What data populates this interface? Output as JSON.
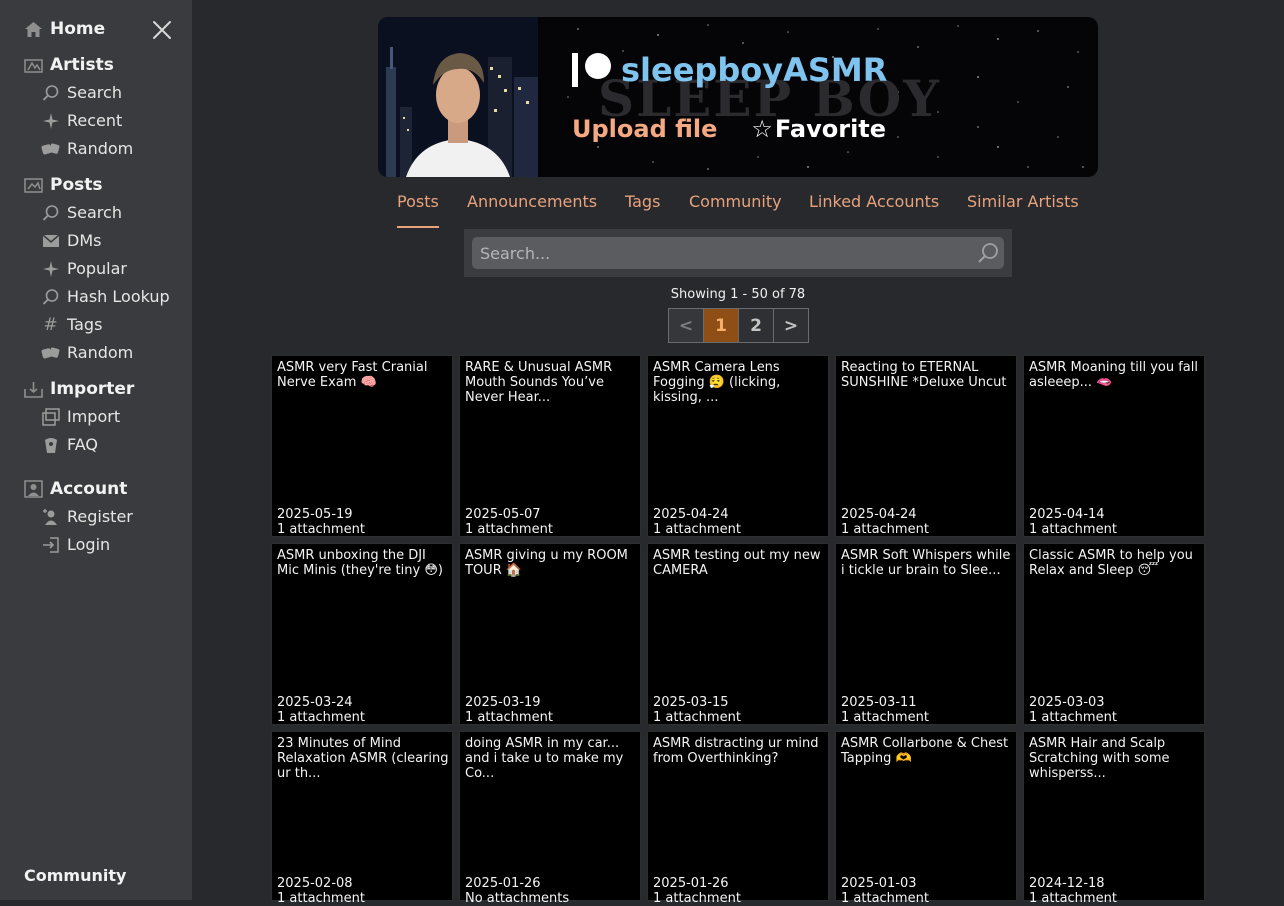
{
  "sidebar": {
    "sections": [
      {
        "title": "Home",
        "icon": "home-icon"
      },
      {
        "title": "Artists",
        "icon": "artists-icon",
        "items": [
          {
            "label": "Search",
            "icon": "search-icon"
          },
          {
            "label": "Recent",
            "icon": "sparkle-icon"
          },
          {
            "label": "Random",
            "icon": "dice-icon"
          }
        ]
      },
      {
        "title": "Posts",
        "icon": "posts-icon",
        "items": [
          {
            "label": "Search",
            "icon": "search-icon"
          },
          {
            "label": "DMs",
            "icon": "mail-icon"
          },
          {
            "label": "Popular",
            "icon": "sparkle-icon"
          },
          {
            "label": "Hash Lookup",
            "icon": "search-icon"
          },
          {
            "label": "Tags",
            "icon": "hash-icon"
          },
          {
            "label": "Random",
            "icon": "dice-icon"
          }
        ]
      },
      {
        "title": "Importer",
        "icon": "importer-icon",
        "items": [
          {
            "label": "Import",
            "icon": "import-icon"
          },
          {
            "label": "FAQ",
            "icon": "faq-icon"
          }
        ]
      },
      {
        "title": "Account",
        "icon": "account-icon",
        "items": [
          {
            "label": "Register",
            "icon": "register-icon"
          },
          {
            "label": "Login",
            "icon": "login-icon"
          }
        ]
      }
    ],
    "footer": "Community"
  },
  "artist": {
    "name": "sleepboyASMR",
    "service_icon": "patreon-icon",
    "banner_text": "SLEEP BOY",
    "upload_label": "Upload file",
    "favorite_label": "Favorite"
  },
  "tabs": [
    "Posts",
    "Announcements",
    "Tags",
    "Community",
    "Linked Accounts",
    "Similar Artists"
  ],
  "active_tab": "Posts",
  "search": {
    "placeholder": "Search..."
  },
  "pagination": {
    "showing": "Showing 1 - 50 of 78",
    "prev": "<",
    "pages": [
      "1",
      "2"
    ],
    "current": "1",
    "next": ">"
  },
  "posts": [
    {
      "title": "ASMR very Fast Cranial Nerve Exam 🧠",
      "date": "2025-05-19",
      "attachments": "1 attachment"
    },
    {
      "title": "RARE & Unusual ASMR Mouth Sounds You’ve Never Hear...",
      "date": "2025-05-07",
      "attachments": "1 attachment"
    },
    {
      "title": "ASMR Camera Lens Fogging 😮‍💨 (licking, kissing, ...",
      "date": "2025-04-24",
      "attachments": "1 attachment"
    },
    {
      "title": "Reacting to ETERNAL SUNSHINE *Deluxe Uncut",
      "date": "2025-04-24",
      "attachments": "1 attachment"
    },
    {
      "title": "ASMR Moaning till you fall asleeep... 🫦",
      "date": "2025-04-14",
      "attachments": "1 attachment"
    },
    {
      "title": "ASMR unboxing the DJI Mic Minis (they're tiny 😳)",
      "date": "2025-03-24",
      "attachments": "1 attachment"
    },
    {
      "title": "ASMR giving u my ROOM TOUR 🏠",
      "date": "2025-03-19",
      "attachments": "1 attachment"
    },
    {
      "title": "ASMR testing out my new CAMERA",
      "date": "2025-03-15",
      "attachments": "1 attachment"
    },
    {
      "title": "ASMR Soft Whispers while i tickle ur brain to Slee...",
      "date": "2025-03-11",
      "attachments": "1 attachment"
    },
    {
      "title": "Classic ASMR to help you Relax and Sleep 😴",
      "date": "2025-03-03",
      "attachments": "1 attachment"
    },
    {
      "title": "23 Minutes of Mind Relaxation ASMR (clearing ur th...",
      "date": "2025-02-08",
      "attachments": "1 attachment"
    },
    {
      "title": "doing ASMR in my car... and i take u to make my Co...",
      "date": "2025-01-26",
      "attachments": "No attachments"
    },
    {
      "title": "ASMR distracting ur mind from Overthinking?",
      "date": "2025-01-26",
      "attachments": "1 attachment"
    },
    {
      "title": "ASMR Collarbone & Chest Tapping 🫶",
      "date": "2025-01-03",
      "attachments": "1 attachment"
    },
    {
      "title": "ASMR Hair and Scalp Scratching with some whisperss...",
      "date": "2024-12-18",
      "attachments": "1 attachment"
    }
  ]
}
